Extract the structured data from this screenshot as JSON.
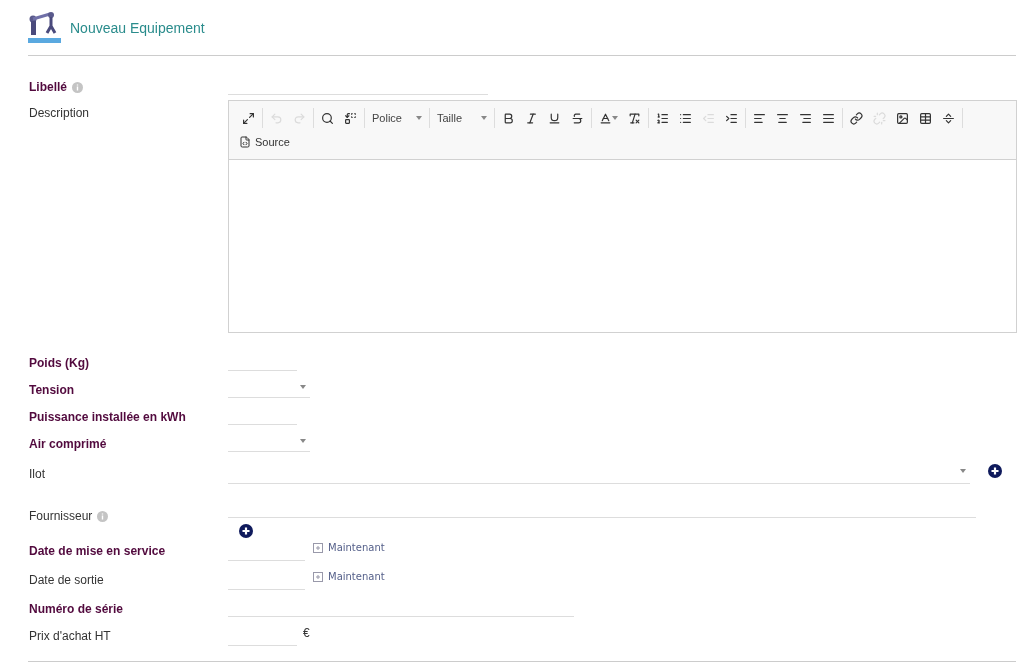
{
  "header": {
    "title": "Nouveau Equipement"
  },
  "fields": [
    {
      "kind": "title",
      "label": "Libellé",
      "required": true,
      "info": true
    },
    {
      "kind": "editor",
      "label": "Description",
      "required": false,
      "info": false,
      "toolbar": [
        [
          {
            "kind": "button",
            "disabled": false
          }
        ],
        [
          {
            "kind": "button",
            "disabled": true
          },
          {
            "kind": "button",
            "disabled": true
          }
        ],
        [
          {
            "kind": "button",
            "disabled": false
          },
          {
            "kind": "button",
            "disabled": false
          }
        ],
        [
          {
            "kind": "combo",
            "label": "Police"
          }
        ],
        [
          {
            "kind": "combo",
            "label": "Taille"
          }
        ],
        [
          {
            "kind": "button",
            "disabled": false
          },
          {
            "kind": "button",
            "disabled": false
          },
          {
            "kind": "button",
            "disabled": false
          },
          {
            "kind": "button",
            "disabled": false
          }
        ],
        [
          {
            "kind": "button",
            "disabled": false
          },
          {
            "kind": "button",
            "disabled": false
          }
        ],
        [
          {
            "kind": "button",
            "disabled": false
          },
          {
            "kind": "button",
            "disabled": false
          },
          {
            "kind": "button",
            "disabled": true
          },
          {
            "kind": "button",
            "disabled": false
          }
        ],
        [
          {
            "kind": "button",
            "disabled": false
          },
          {
            "kind": "button",
            "disabled": false
          },
          {
            "kind": "button",
            "disabled": false
          },
          {
            "kind": "button",
            "disabled": false
          }
        ],
        [
          {
            "kind": "button",
            "disabled": false
          },
          {
            "kind": "button",
            "disabled": true
          },
          {
            "kind": "button",
            "disabled": false
          },
          {
            "kind": "button",
            "disabled": false
          },
          {
            "kind": "button",
            "disabled": false
          }
        ]
      ],
      "source_label": "Source"
    },
    {
      "kind": "number",
      "label": "Poids (Kg)",
      "required": true,
      "info": false
    },
    {
      "kind": "select",
      "label": "Tension",
      "required": true,
      "info": false
    },
    {
      "kind": "number",
      "label": "Puissance installée en kWh",
      "required": true,
      "info": false
    },
    {
      "kind": "select",
      "label": "Air comprimé",
      "required": true,
      "info": false
    },
    {
      "kind": "lookup",
      "label": "Ilot",
      "required": false,
      "info": false,
      "add": true
    },
    {
      "kind": "autocomplete",
      "label": "Fournisseur",
      "required": false,
      "info": true,
      "add": true
    },
    {
      "kind": "date",
      "label": "Date de mise en service",
      "required": true,
      "info": false,
      "shortcut": "Maintenant"
    },
    {
      "kind": "date",
      "label": "Date de sortie",
      "required": false,
      "info": false,
      "shortcut": "Maintenant"
    },
    {
      "kind": "text",
      "label": "Numéro de série",
      "required": true,
      "info": false
    },
    {
      "kind": "price",
      "label": "Prix d'achat HT",
      "required": false,
      "info": false,
      "unit": "€"
    }
  ]
}
